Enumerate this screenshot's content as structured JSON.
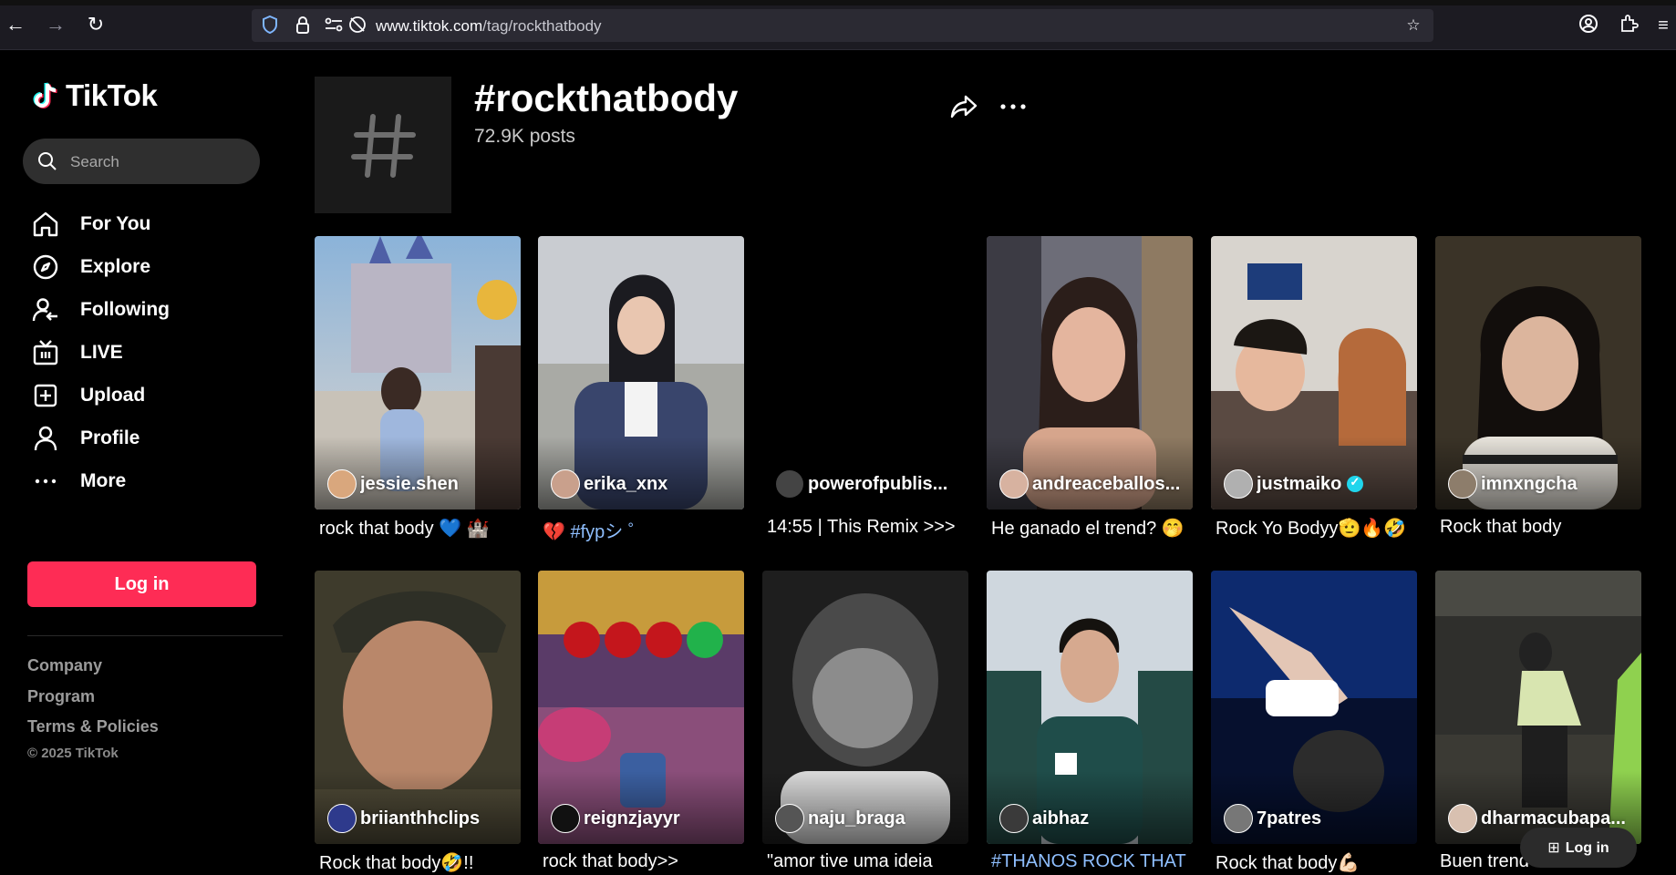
{
  "browser": {
    "url_host": "www.tiktok.com",
    "url_path": "/tag/rockthatbody"
  },
  "sidebar": {
    "logo_text": "TikTok",
    "search_placeholder": "Search",
    "nav": [
      {
        "label": "For You",
        "icon": "home-icon"
      },
      {
        "label": "Explore",
        "icon": "compass-icon"
      },
      {
        "label": "Following",
        "icon": "following-icon"
      },
      {
        "label": "LIVE",
        "icon": "live-tv-icon"
      },
      {
        "label": "Upload",
        "icon": "upload-plus-icon"
      },
      {
        "label": "Profile",
        "icon": "profile-icon"
      },
      {
        "label": "More",
        "icon": "more-dots-icon"
      }
    ],
    "login_label": "Log in",
    "footer_links": [
      "Company",
      "Program",
      "Terms & Policies"
    ],
    "copyright": "© 2025 TikTok"
  },
  "header": {
    "title": "#rockthatbody",
    "posts": "72.9K posts"
  },
  "videos": [
    {
      "author": "jessie.shen",
      "caption": "rock that body 💙 🏰",
      "verified": false
    },
    {
      "author": "erika_xnx",
      "caption": "💔 #fypシ ゜",
      "verified": false
    },
    {
      "author": "powerofpublis...",
      "caption": "14:55 | This Remix >>>",
      "verified": false
    },
    {
      "author": "andreaceballos...",
      "caption": "He ganado el trend? 🤭",
      "verified": false
    },
    {
      "author": "justmaiko",
      "caption": "Rock Yo Bodyy🫡🔥🤣",
      "verified": true
    },
    {
      "author": "imnxngcha",
      "caption": "Rock that body",
      "verified": false
    },
    {
      "author": "briianthhclips",
      "caption": "Rock that body🤣!!",
      "verified": false
    },
    {
      "author": "reignzjayyr",
      "caption": "rock that body>>",
      "verified": false
    },
    {
      "author": "naju_braga",
      "caption": "\"amor tive uma ideia",
      "verified": false
    },
    {
      "author": "aibhaz",
      "caption": "#THANOS ROCK THAT",
      "verified": false
    },
    {
      "author": "7patres",
      "caption": "Rock that body💪🏻",
      "verified": false
    },
    {
      "author": "dharmacubapa...",
      "caption": "Buen trend",
      "verified": false
    }
  ],
  "float_login_label": "Log in",
  "colors": {
    "accent": "#fe2c55",
    "background": "#000000",
    "verified": "#20d5ec"
  }
}
